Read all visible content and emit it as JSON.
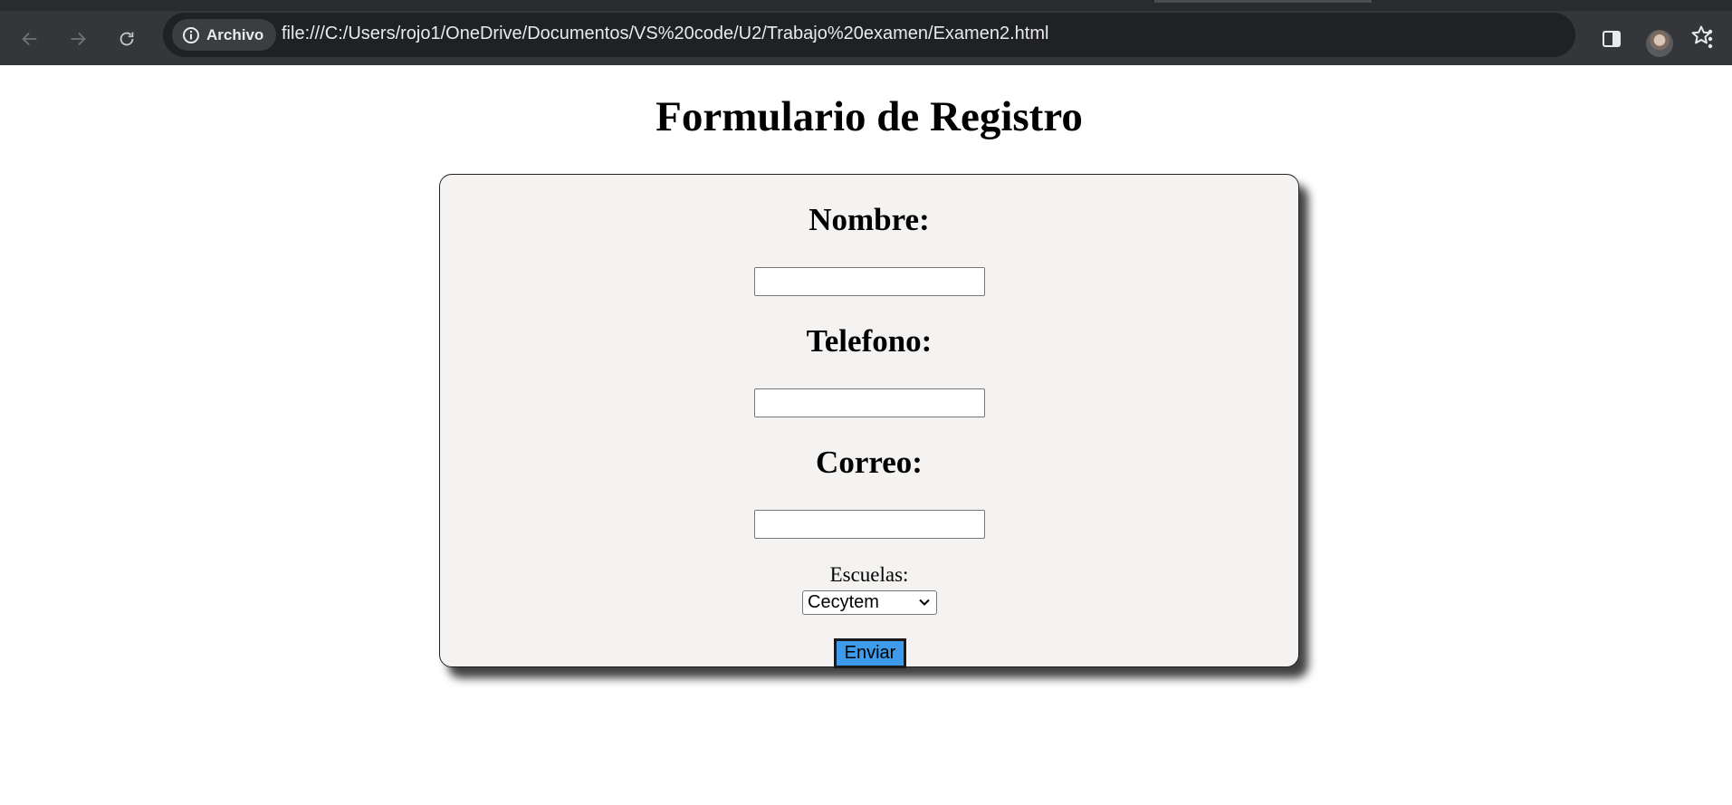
{
  "browser": {
    "security_chip_label": "Archivo",
    "url": "file:///C:/Users/rojo1/OneDrive/Documentos/VS%20code/U2/Trabajo%20examen/Examen2.html"
  },
  "page": {
    "title": "Formulario de Registro",
    "fields": {
      "nombre_label": "Nombre:",
      "nombre_value": "",
      "telefono_label": "Telefono:",
      "telefono_value": "",
      "correo_label": "Correo:",
      "correo_value": ""
    },
    "escuelas_label": "Escuelas:",
    "escuelas_selected": "Cecytem",
    "submit_label": "Enviar"
  },
  "colors": {
    "toolbar": "#35363a",
    "omnibox": "#202124",
    "card_background": "#f4f3f1",
    "submit_button": "#3d9be9"
  }
}
